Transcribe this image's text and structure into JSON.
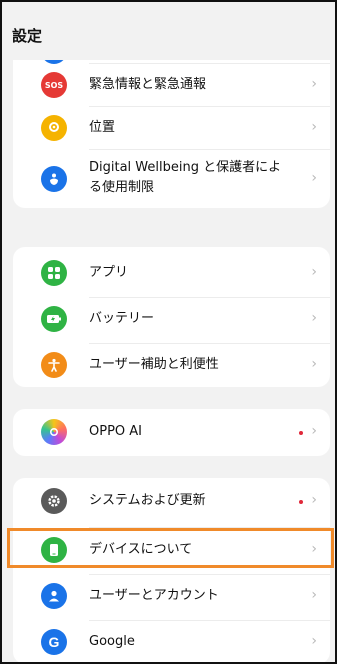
{
  "header": {
    "title": "設定"
  },
  "groups": [
    {
      "items": [
        {
          "label": "緊急情報と緊急通報",
          "icon": "sos-icon",
          "icon_text": "SOS",
          "color": "#e53935"
        },
        {
          "label": "位置",
          "icon": "location-icon",
          "color": "#f5b300"
        },
        {
          "label_line1": "Digital Wellbeing と保護者によ",
          "label_line2": "る使用制限",
          "icon": "digital-wellbeing-icon",
          "color": "#1a73e8"
        }
      ]
    },
    {
      "items": [
        {
          "label": "アプリ",
          "icon": "apps-icon",
          "color": "#2fb344"
        },
        {
          "label": "バッテリー",
          "icon": "battery-icon",
          "color": "#2fb344"
        },
        {
          "label": "ユーザー補助と利便性",
          "icon": "accessibility-icon",
          "color": "#f28c18"
        }
      ]
    },
    {
      "items": [
        {
          "label": "OPPO AI",
          "icon": "oppo-ai-icon",
          "has_dot": true
        }
      ]
    },
    {
      "items": [
        {
          "label": "システムおよび更新",
          "icon": "gear-icon",
          "color": "#5a5a5a",
          "has_dot": true
        },
        {
          "label": "デバイスについて",
          "icon": "device-icon",
          "color": "#2fb344"
        },
        {
          "label": "ユーザーとアカウント",
          "icon": "user-icon",
          "color": "#1a73e8"
        },
        {
          "label": "Google",
          "icon": "google-icon",
          "color": "#1a73e8"
        }
      ]
    }
  ],
  "highlight_color": "#f08a2a",
  "chevron": "›"
}
